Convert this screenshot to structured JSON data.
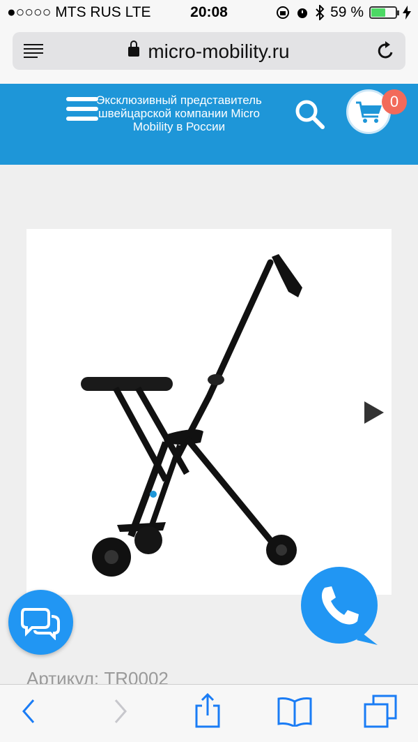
{
  "status_bar": {
    "carrier": "●○○○○ MTS RUS  LTE",
    "time": "20:08",
    "battery": "59 %",
    "battery_level": 0.59,
    "icons": [
      "orientation-lock-icon",
      "alarm-icon",
      "bluetooth-icon",
      "battery-icon",
      "charging-icon"
    ]
  },
  "browser": {
    "url": "micro-mobility.ru",
    "icons": [
      "reader-icon",
      "lock-icon",
      "reload-icon"
    ]
  },
  "header": {
    "tagline": "Эксклюзивный представитель швейцарской компании Micro Mobility в России",
    "cart_count": "0",
    "icons": [
      "hamburger-icon",
      "search-icon",
      "cart-icon"
    ]
  },
  "product": {
    "image": "stroller-photo",
    "sku": "Артикул: TR0002"
  },
  "floating": {
    "icons": [
      "chat-icon",
      "phone-icon"
    ]
  },
  "toolbar": {
    "icons": [
      "back-icon",
      "forward-icon",
      "share-icon",
      "bookmarks-icon",
      "tabs-icon"
    ]
  },
  "colors": {
    "brand_blue": "#1e96d8",
    "badge_red": "#f26a5a",
    "floating_blue": "#2196f3",
    "battery_green": "#4cd964",
    "ios_blue": "#1a7cf5"
  }
}
